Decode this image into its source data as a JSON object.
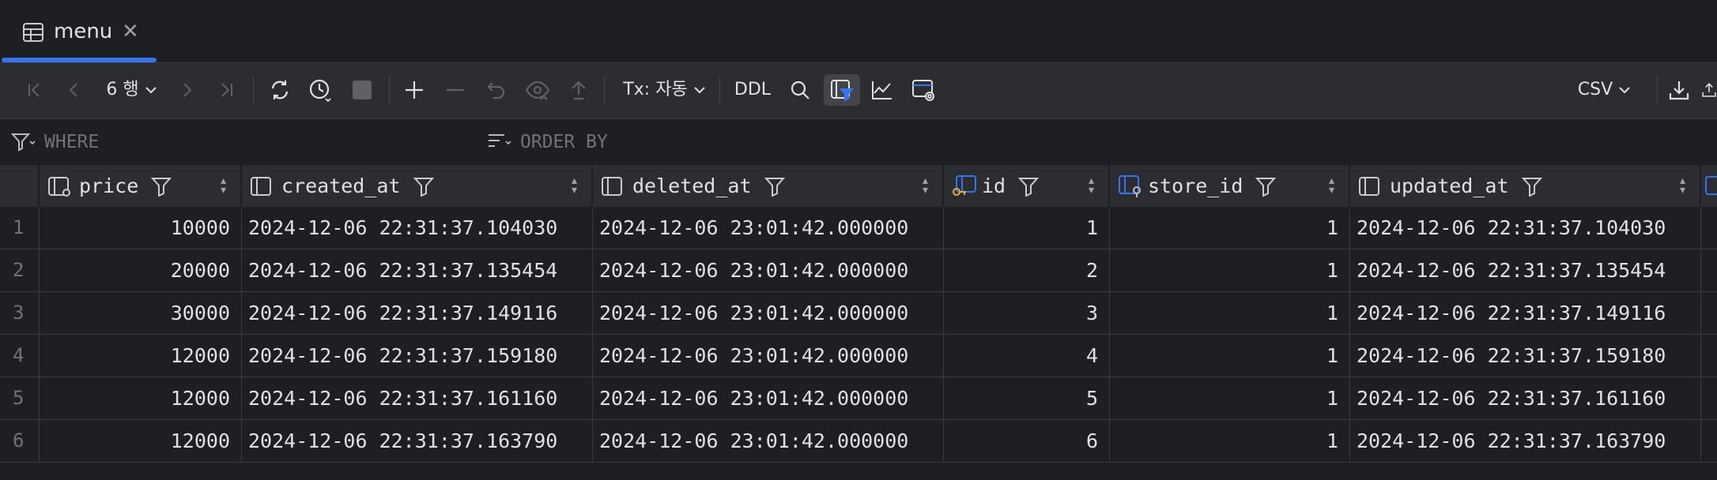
{
  "tab": {
    "label": "menu",
    "close": "✕"
  },
  "toolbar": {
    "rows_label": "6 행",
    "tx_label": "Tx: 자동",
    "ddl_label": "DDL",
    "export_format": "CSV"
  },
  "filter": {
    "where_label": "WHERE",
    "order_by_label": "ORDER BY"
  },
  "table": {
    "columns": [
      {
        "name": "price",
        "icon": "column-icon"
      },
      {
        "name": "created_at",
        "icon": "column-icon"
      },
      {
        "name": "deleted_at",
        "icon": "column-icon"
      },
      {
        "name": "id",
        "icon": "primary-key-icon"
      },
      {
        "name": "store_id",
        "icon": "foreign-key-icon"
      },
      {
        "name": "updated_at",
        "icon": "column-icon"
      }
    ],
    "rows": [
      {
        "n": "1",
        "price": "10000",
        "created_at": "2024-12-06 22:31:37.104030",
        "deleted_at": "2024-12-06 23:01:42.000000",
        "id": "1",
        "store_id": "1",
        "updated_at": "2024-12-06 22:31:37.104030"
      },
      {
        "n": "2",
        "price": "20000",
        "created_at": "2024-12-06 22:31:37.135454",
        "deleted_at": "2024-12-06 23:01:42.000000",
        "id": "2",
        "store_id": "1",
        "updated_at": "2024-12-06 22:31:37.135454"
      },
      {
        "n": "3",
        "price": "30000",
        "created_at": "2024-12-06 22:31:37.149116",
        "deleted_at": "2024-12-06 23:01:42.000000",
        "id": "3",
        "store_id": "1",
        "updated_at": "2024-12-06 22:31:37.149116"
      },
      {
        "n": "4",
        "price": "12000",
        "created_at": "2024-12-06 22:31:37.159180",
        "deleted_at": "2024-12-06 23:01:42.000000",
        "id": "4",
        "store_id": "1",
        "updated_at": "2024-12-06 22:31:37.159180"
      },
      {
        "n": "5",
        "price": "12000",
        "created_at": "2024-12-06 22:31:37.161160",
        "deleted_at": "2024-12-06 23:01:42.000000",
        "id": "5",
        "store_id": "1",
        "updated_at": "2024-12-06 22:31:37.161160"
      },
      {
        "n": "6",
        "price": "12000",
        "created_at": "2024-12-06 22:31:37.163790",
        "deleted_at": "2024-12-06 23:01:42.000000",
        "id": "6",
        "store_id": "1",
        "updated_at": "2024-12-06 22:31:37.163790"
      }
    ]
  },
  "colors": {
    "accent": "#3574f0",
    "background": "#1e1f22",
    "panel": "#2b2d30"
  }
}
